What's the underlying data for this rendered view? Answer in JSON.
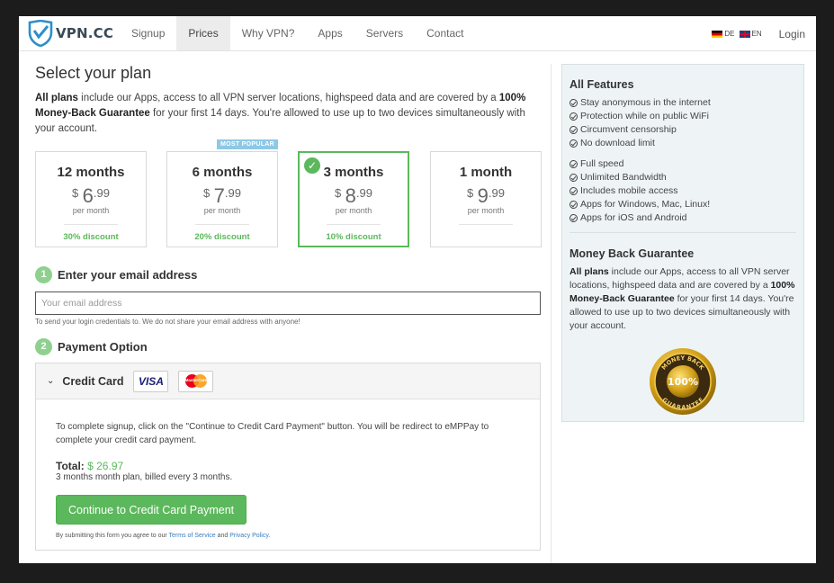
{
  "nav": {
    "logo_text": "VPN.CC",
    "links": [
      "Signup",
      "Prices",
      "Why VPN?",
      "Apps",
      "Servers",
      "Contact"
    ],
    "active_index": 1,
    "lang_de": "DE",
    "lang_en": "EN",
    "login": "Login"
  },
  "main": {
    "title": "Select your plan",
    "intro": {
      "lead_bold": "All plans",
      "middle": " include our Apps, access to all VPN server locations, highspeed data and are covered by a ",
      "guarantee_bold": "100% Money-Back Guarantee",
      "tail": " for your first 14 days. You're allowed to use up to two devices simultaneously with your account."
    },
    "plans": [
      {
        "name": "12 months",
        "currency": "$",
        "price_whole": "6",
        "price_cents": ".99",
        "per": "per month",
        "discount": "30% discount",
        "badge": "",
        "selected": false
      },
      {
        "name": "6 months",
        "currency": "$",
        "price_whole": "7",
        "price_cents": ".99",
        "per": "per month",
        "discount": "20% discount",
        "badge": "MOST POPULAR",
        "selected": false
      },
      {
        "name": "3 months",
        "currency": "$",
        "price_whole": "8",
        "price_cents": ".99",
        "per": "per month",
        "discount": "10% discount",
        "badge": "",
        "selected": true
      },
      {
        "name": "1 month",
        "currency": "$",
        "price_whole": "9",
        "price_cents": ".99",
        "per": "per month",
        "discount": "",
        "badge": "",
        "selected": false
      }
    ],
    "step1": {
      "num": "1",
      "title": "Enter your email address",
      "placeholder": "Your email address",
      "hint": "To send your login credentials to. We do not share your email address with anyone!"
    },
    "step2": {
      "num": "2",
      "title": "Payment Option"
    },
    "payment": {
      "method": "Credit Card",
      "visa": "VISA",
      "mastercard": "MasterCard",
      "text": "To complete signup, click on the \"Continue to Credit Card Payment\" button. You will be redirect to eMPPay to complete your credit card payment.",
      "total_label": "Total:",
      "total_amount": "$ 26.97",
      "total_sub": "3 months month plan, billed every 3 months.",
      "cta": "Continue to Credit Card Payment",
      "terms_pre": "By submitting this form you agree to our ",
      "terms_link": "Terms of Service",
      "terms_and": " and ",
      "privacy_link": "Privacy Policy",
      "terms_end": "."
    }
  },
  "sidebar": {
    "features_title": "All Features",
    "features_a": [
      "Stay anonymous in the internet",
      "Protection while on public WiFi",
      "Circumvent censorship",
      "No download limit"
    ],
    "features_b": [
      "Full speed",
      "Unlimited Bandwidth",
      "Includes mobile access",
      "Apps for Windows, Mac, Linux!",
      "Apps for iOS and Android"
    ],
    "guarantee_title": "Money Back Guarantee",
    "guarantee": {
      "lead_bold": "All plans",
      "middle": " include our Apps, access to all VPN server locations, highspeed data and are covered by a ",
      "bold": "100% Money-Back Guarantee",
      "tail": " for your first 14 days. You're allowed to use up to two devices simultaneously with your account."
    },
    "seal": {
      "top": "MONEY BACK",
      "center": "100%",
      "bottom": "GUARANTEE"
    }
  },
  "colors": {
    "accent_green": "#5cb85c",
    "badge_blue": "#8ec8e6",
    "sidebar_bg": "#eef4f6",
    "seal_gold": "#d4a017"
  }
}
